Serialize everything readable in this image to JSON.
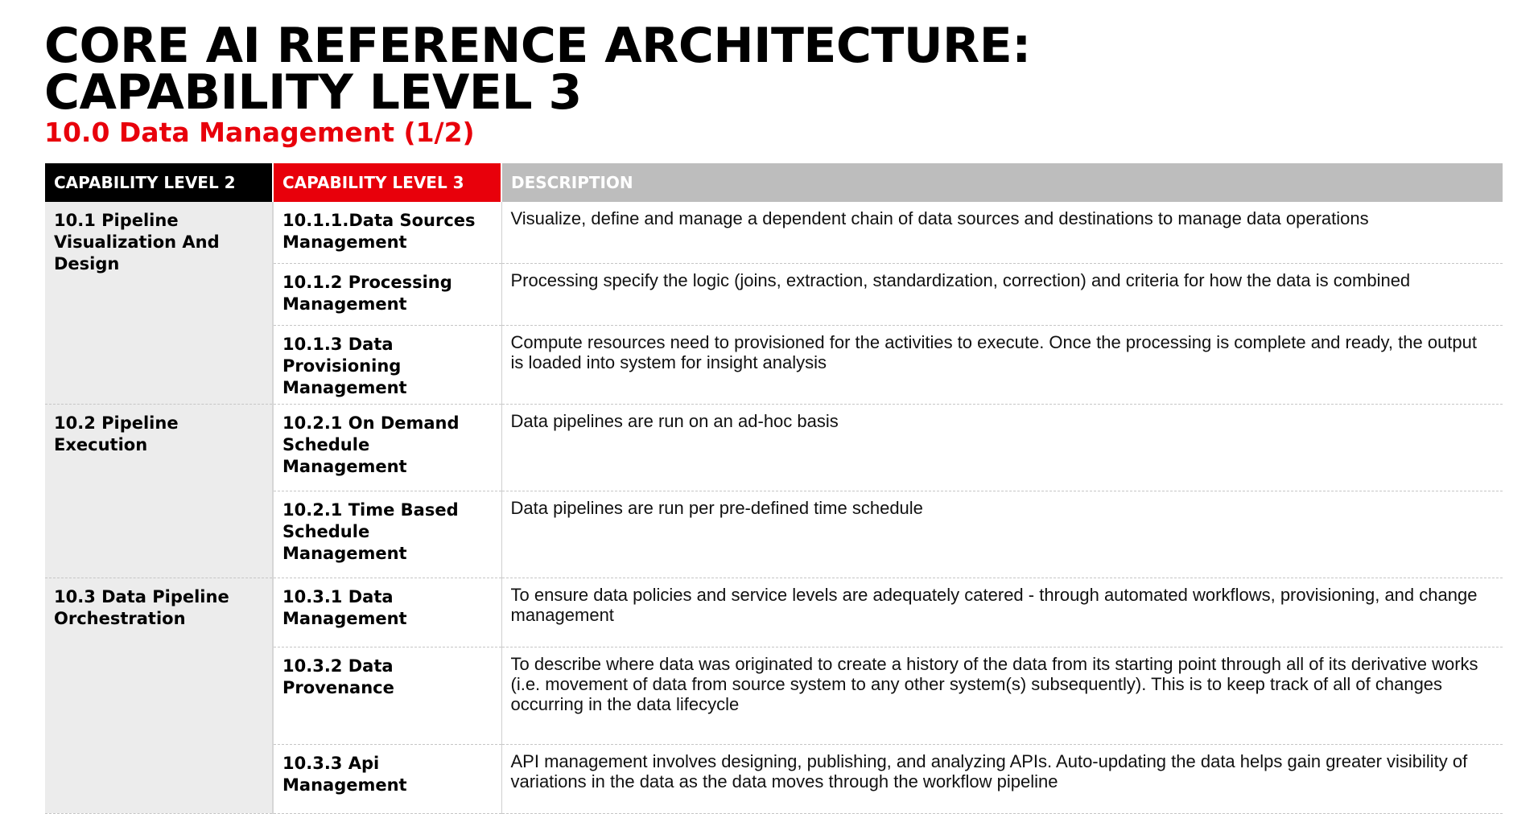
{
  "header": {
    "title_line1": "CORE AI REFERENCE ARCHITECTURE:",
    "title_line2": "CAPABILITY LEVEL 3",
    "subtitle": "10.0 Data Management (1/2)"
  },
  "table": {
    "columns": {
      "level2": "CAPABILITY LEVEL 2",
      "level3": "CAPABILITY LEVEL 3",
      "description": "DESCRIPTION"
    },
    "groups": [
      {
        "level2": "10.1 Pipeline Visualization And Design",
        "rows": [
          {
            "level3": "10.1.1.Data Sources Management",
            "description": "Visualize, define and manage a dependent chain of data sources and destinations to manage data operations"
          },
          {
            "level3": "10.1.2  Processing Management",
            "description": "Processing specify the logic (joins, extraction, standardization, correction) and criteria for how the data is combined"
          },
          {
            "level3": "10.1.3  Data Provisioning Management",
            "description": "Compute resources need to provisioned for the activities to execute. Once the processing is complete and ready, the output is loaded into system for insight analysis"
          }
        ]
      },
      {
        "level2": "10.2 Pipeline Execution",
        "rows": [
          {
            "level3": "10.2.1 On Demand Schedule Management",
            "description": "Data pipelines are run on an ad-hoc basis"
          },
          {
            "level3": "10.2.1 Time Based Schedule Management",
            "description": "Data pipelines are run per pre-defined time schedule"
          }
        ]
      },
      {
        "level2": "10.3 Data Pipeline Orchestration",
        "rows": [
          {
            "level3": "10.3.1 Data Management",
            "description": "To ensure data policies and service levels are adequately catered - through automated workflows, provisioning, and change management"
          },
          {
            "level3": "10.3.2 Data Provenance",
            "description": "To describe where data was originated to create a history of the data from its starting point through all of its derivative works (i.e. movement of data from source system to any other system(s) subsequently). This is to keep track of all of changes occurring in the data lifecycle"
          },
          {
            "level3": "10.3.3 Api Management",
            "description": "API management involves designing, publishing, and analyzing APIs. Auto-updating the data helps gain greater visibility of variations in the data as the data moves through the workflow pipeline"
          }
        ]
      }
    ]
  }
}
